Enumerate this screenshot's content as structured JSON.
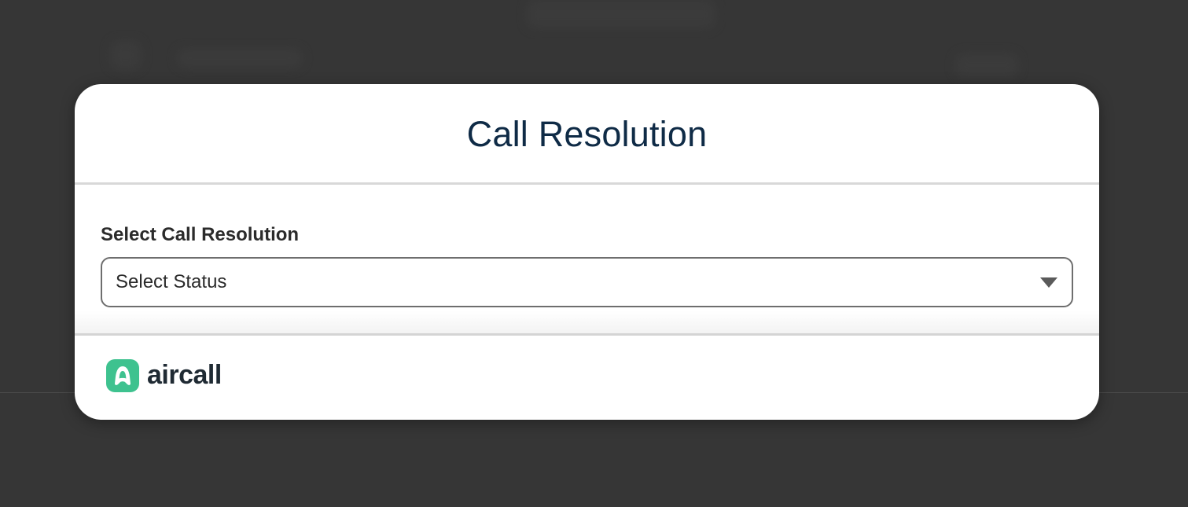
{
  "modal": {
    "title": "Call Resolution"
  },
  "form": {
    "label": "Select Call Resolution",
    "select": {
      "value": "Select Status"
    }
  },
  "footer": {
    "brand_name": "aircall",
    "brand_color": "#3ec28f"
  },
  "icons": {
    "dropdown": "caret-down-icon",
    "logo": "aircall-logo-icon"
  }
}
